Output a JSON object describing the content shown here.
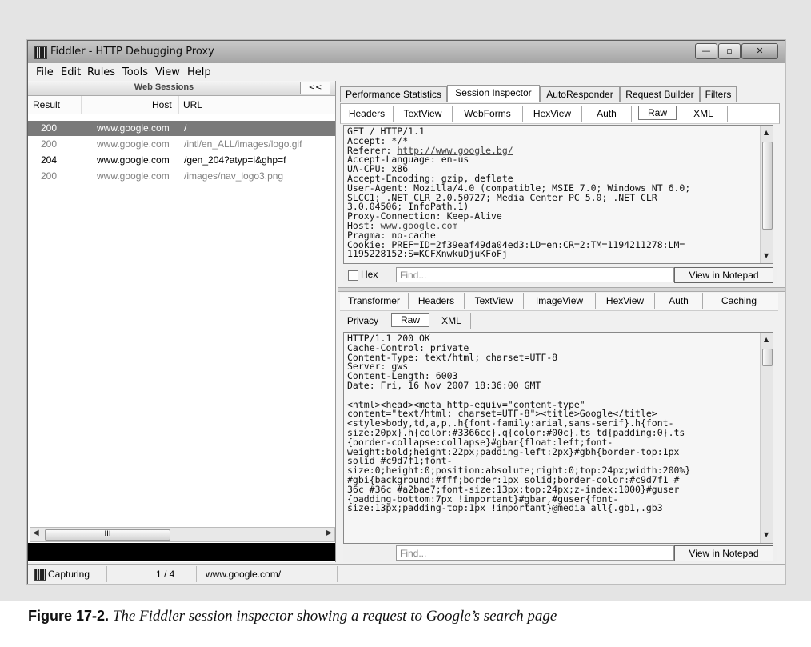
{
  "window": {
    "title": "Fiddler - HTTP Debugging Proxy",
    "controls": [
      "minimize",
      "maximize",
      "close"
    ]
  },
  "menu": [
    "File",
    "Edit",
    "Rules",
    "Tools",
    "View",
    "Help"
  ],
  "web_sessions": {
    "title": "Web Sessions",
    "collapse_label": "<<",
    "columns": {
      "result": "Result",
      "host": "Host",
      "url": "URL"
    },
    "rows": [
      {
        "result": "200",
        "host": "www.google.com",
        "url": "/",
        "state": "selected"
      },
      {
        "result": "200",
        "host": "www.google.com",
        "url": "/intl/en_ALL/images/logo.gif",
        "state": "grey"
      },
      {
        "result": "204",
        "host": "www.google.com",
        "url": "/gen_204?atyp=i&ghp=f",
        "state": "black"
      },
      {
        "result": "200",
        "host": "www.google.com",
        "url": "/images/nav_logo3.png",
        "state": "grey"
      }
    ],
    "scroll_thumb": "III"
  },
  "main_tabs": [
    "Performance Statistics",
    "Session Inspector",
    "AutoResponder",
    "Request Builder",
    "Filters"
  ],
  "active_main_tab": "Session Inspector",
  "request": {
    "tabs": [
      "Headers",
      "TextView",
      "WebForms",
      "HexView",
      "Auth",
      "Raw",
      "XML"
    ],
    "active_tab": "Raw",
    "lines": [
      "GET / HTTP/1.1",
      "Accept: */*",
      "Referer: ",
      "Accept-Language: en-us",
      "UA-CPU: x86",
      "Accept-Encoding: gzip, deflate",
      "User-Agent: Mozilla/4.0 (compatible; MSIE 7.0; Windows NT 6.0;",
      "SLCC1; .NET CLR 2.0.50727; Media Center PC 5.0; .NET CLR",
      "3.0.04506; InfoPath.1)",
      "Proxy-Connection: Keep-Alive",
      "Host: ",
      "Pragma: no-cache",
      "Cookie: PREF=ID=2f39eaf49da04ed3:LD=en:CR=2:TM=1194211278:LM=",
      "1195228152:S=KCFXnwkuDjuKFoFj"
    ],
    "referer_link": "http://www.google.bg/",
    "host_link": "www.google.com",
    "hex_label": "Hex",
    "find_placeholder": "Find...",
    "notepad_button": "View in Notepad"
  },
  "response": {
    "tabs_row1": [
      "Transformer",
      "Headers",
      "TextView",
      "ImageView",
      "HexView",
      "Auth",
      "Caching"
    ],
    "tabs_row2": [
      "Privacy",
      "Raw",
      "XML"
    ],
    "active_tab": "Raw",
    "text": "HTTP/1.1 200 OK\nCache-Control: private\nContent-Type: text/html; charset=UTF-8\nServer: gws\nContent-Length: 6003\nDate: Fri, 16 Nov 2007 18:36:00 GMT\n\n<html><head><meta http-equiv=\"content-type\"\ncontent=\"text/html; charset=UTF-8\"><title>Google</title>\n<style>body,td,a,p,.h{font-family:arial,sans-serif}.h{font-\nsize:20px}.h{color:#3366cc}.q{color:#00c}.ts td{padding:0}.ts\n{border-collapse:collapse}#gbar{float:left;font-\nweight:bold;height:22px;padding-left:2px}#gbh{border-top:1px\nsolid #c9d7f1;font-\nsize:0;height:0;position:absolute;right:0;top:24px;width:200%}\n#gbi{background:#fff;border:1px solid;border-color:#c9d7f1 #\n36c #36c #a2bae7;font-size:13px;top:24px;z-index:1000}#guser\n{padding-bottom:7px !important}#gbar,#guser{font-\nsize:13px;padding-top:1px !important}@media all{.gb1,.gb3",
    "find_placeholder": "Find...",
    "notepad_button": "View in Notepad"
  },
  "status": {
    "capturing": "Capturing",
    "count": "1 / 4",
    "url": "www.google.com/"
  },
  "caption": {
    "label": "Figure 17-2.",
    "text": "The Fiddler session inspector showing a request to Google’s search page"
  }
}
